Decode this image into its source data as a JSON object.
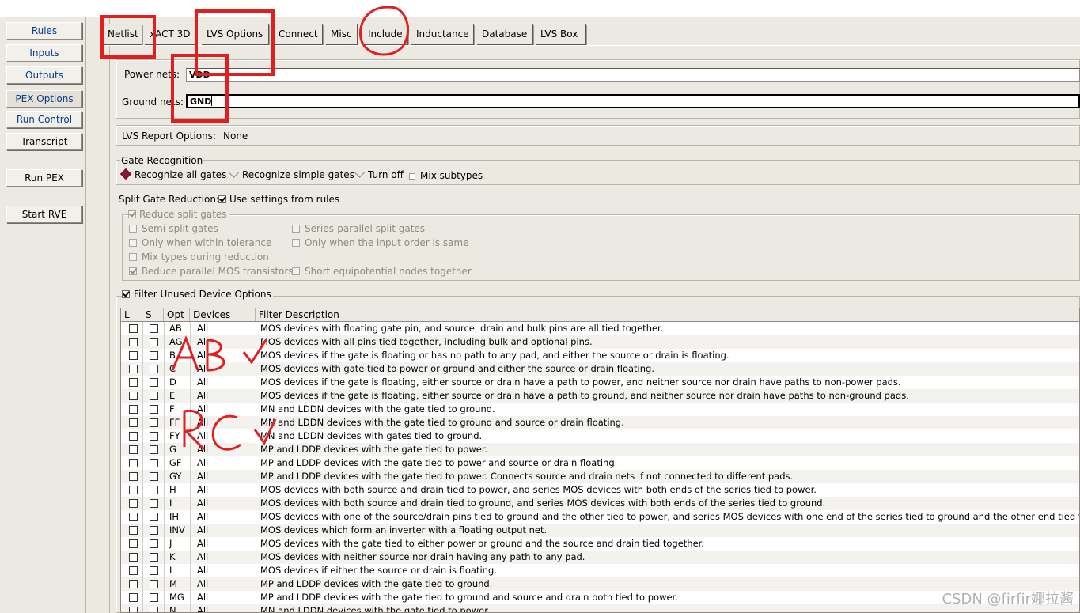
{
  "sidebar": {
    "items": [
      {
        "label": "Rules"
      },
      {
        "label": "Inputs"
      },
      {
        "label": "Outputs"
      },
      {
        "label": "PEX Options"
      },
      {
        "label": "Run Control"
      },
      {
        "label": "Transcript"
      }
    ],
    "run_pex": "Run PEX",
    "start_rve": "Start RVE"
  },
  "tabs": [
    {
      "label": "Netlist"
    },
    {
      "label": "xACT 3D"
    },
    {
      "label": "LVS Options"
    },
    {
      "label": "Connect"
    },
    {
      "label": "Misc"
    },
    {
      "label": "Include"
    },
    {
      "label": "Inductance"
    },
    {
      "label": "Database"
    },
    {
      "label": "LVS Box"
    }
  ],
  "nets": {
    "power_label": "Power nets:",
    "power_value": "VDD",
    "ground_label": "Ground nets:",
    "ground_value": "GND"
  },
  "lvs_report": {
    "label": "LVS Report Options:",
    "value": "None"
  },
  "gate_recognition": {
    "title": "Gate Recognition",
    "options": [
      "Recognize all gates",
      "Recognize simple gates",
      "Turn off"
    ],
    "selected": "Recognize all gates",
    "mix_subtypes": "Mix subtypes"
  },
  "split_gate": {
    "label": "Split Gate Reduction:",
    "use_settings": "Use settings from rules",
    "reduce_split": "Reduce split gates",
    "left": [
      "Semi-split gates",
      "Only when within tolerance",
      "Mix types during reduction",
      "Reduce parallel MOS transistors"
    ],
    "right": [
      "Series-parallel split gates",
      "Only when the input order is same",
      "Short equipotential nodes together"
    ]
  },
  "filter": {
    "label": "Filter Unused Device Options",
    "headers": {
      "l": "L",
      "s": "S",
      "opt": "Opt",
      "devices": "Devices",
      "desc": "Filter Description"
    },
    "rows": [
      {
        "opt": "AB",
        "dev": "All",
        "desc": "MOS devices with floating gate pin, and source, drain and bulk pins are all tied together."
      },
      {
        "opt": "AG",
        "dev": "All",
        "desc": "MOS devices with all pins tied together, including bulk and optional pins."
      },
      {
        "opt": "B",
        "dev": "All",
        "desc": "MOS devices if the gate is floating or has no path to any pad, and either the source or drain is floating."
      },
      {
        "opt": "C",
        "dev": "All",
        "desc": "MOS devices with gate tied to power or ground and either the source or drain floating."
      },
      {
        "opt": "D",
        "dev": "All",
        "desc": "MOS devices if the gate is floating, either source or drain have a path to power, and neither source nor drain have paths to non-power pads."
      },
      {
        "opt": "E",
        "dev": "All",
        "desc": "MOS devices if the gate is floating, either source or drain have a path to ground, and neither source nor drain have paths to non-ground pads."
      },
      {
        "opt": "F",
        "dev": "All",
        "desc": "MN and LDDN devices with the gate tied to ground."
      },
      {
        "opt": "FF",
        "dev": "All",
        "desc": "MN and LDDN devices with the gate tied to ground and source or drain floating."
      },
      {
        "opt": "FY",
        "dev": "All",
        "desc": "MN and LDDN devices with gates tied to ground."
      },
      {
        "opt": "G",
        "dev": "All",
        "desc": "MP and LDDP devices with the gate tied to power."
      },
      {
        "opt": "GF",
        "dev": "All",
        "desc": "MP and LDDP devices with the gate tied to power and source or drain floating."
      },
      {
        "opt": "GY",
        "dev": "All",
        "desc": "MP and LDDP devices with the gate tied to power. Connects source and drain nets if not connected to different pads."
      },
      {
        "opt": "H",
        "dev": "All",
        "desc": "MOS devices with both source and drain tied to power, and series MOS devices with both ends of the series tied to power."
      },
      {
        "opt": "I",
        "dev": "All",
        "desc": "MOS devices with both source and drain tied to ground, and series MOS devices with both ends of the series tied to ground."
      },
      {
        "opt": "IH",
        "dev": "All",
        "desc": "MOS devices with one of the source/drain pins tied to ground and the other tied to power, and series MOS devices with one end of the series tied to ground and the other end tied to pow"
      },
      {
        "opt": "INV",
        "dev": "All",
        "desc": "MOS devices which form an inverter with a floating output net."
      },
      {
        "opt": "J",
        "dev": "All",
        "desc": "MOS devices with the gate tied to either power or ground and the source and drain tied together."
      },
      {
        "opt": "K",
        "dev": "All",
        "desc": "MOS devices with neither source nor drain having any path to any pad."
      },
      {
        "opt": "L",
        "dev": "All",
        "desc": "MOS devices if either the source or drain is floating."
      },
      {
        "opt": "M",
        "dev": "All",
        "desc": "MP and LDDP devices with the gate tied to ground."
      },
      {
        "opt": "MG",
        "dev": "All",
        "desc": "MP and LDDP devices with the gate tied to ground and source and drain both tied to power."
      },
      {
        "opt": "N",
        "dev": "All",
        "desc": "MN and LDDN devices with the gate tied to power."
      }
    ]
  },
  "annotations": {
    "text1": "ABV",
    "text2": "RCV"
  },
  "watermark": "CSDN @firfir娜拉酱",
  "colors": {
    "annotation": "#e02020",
    "accent": "#0a3a8c",
    "radio": "#8a1a3a"
  }
}
